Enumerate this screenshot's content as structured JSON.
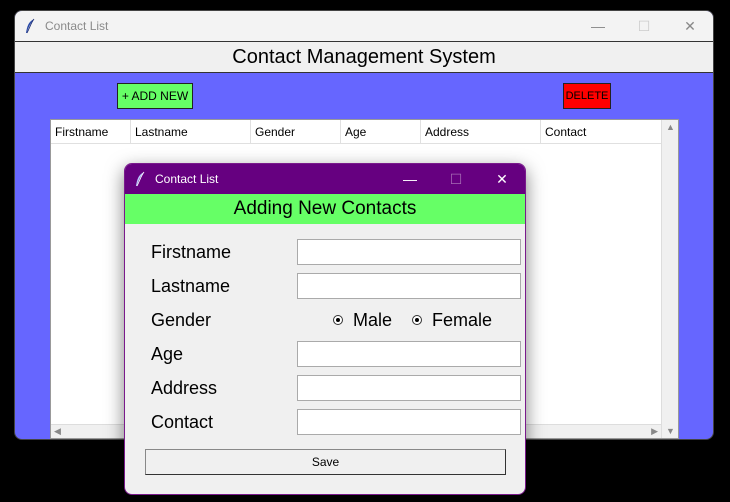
{
  "main_window": {
    "title": "Contact List",
    "heading": "Contact Management System",
    "add_button": "+ ADD NEW",
    "delete_button": "DELETE",
    "columns": [
      "Firstname",
      "Lastname",
      "Gender",
      "Age",
      "Address",
      "Contact"
    ],
    "controls": {
      "minimize": "—",
      "maximize": "☐",
      "close": "✕"
    },
    "colors": {
      "background": "#6666ff",
      "add": "#66ff66",
      "delete": "#ff0000"
    }
  },
  "popup": {
    "title": "Contact List",
    "heading": "Adding New Contacts",
    "fields": {
      "firstname": {
        "label": "Firstname",
        "value": ""
      },
      "lastname": {
        "label": "Lastname",
        "value": ""
      },
      "gender": {
        "label": "Gender",
        "options": [
          "Male",
          "Female"
        ]
      },
      "age": {
        "label": "Age",
        "value": ""
      },
      "address": {
        "label": "Address",
        "value": ""
      },
      "contact": {
        "label": "Contact",
        "value": ""
      }
    },
    "save_button": "Save",
    "controls": {
      "minimize": "—",
      "maximize": "☐",
      "close": "✕"
    },
    "colors": {
      "titlebar": "#660080",
      "heading": "#66ff66"
    }
  }
}
